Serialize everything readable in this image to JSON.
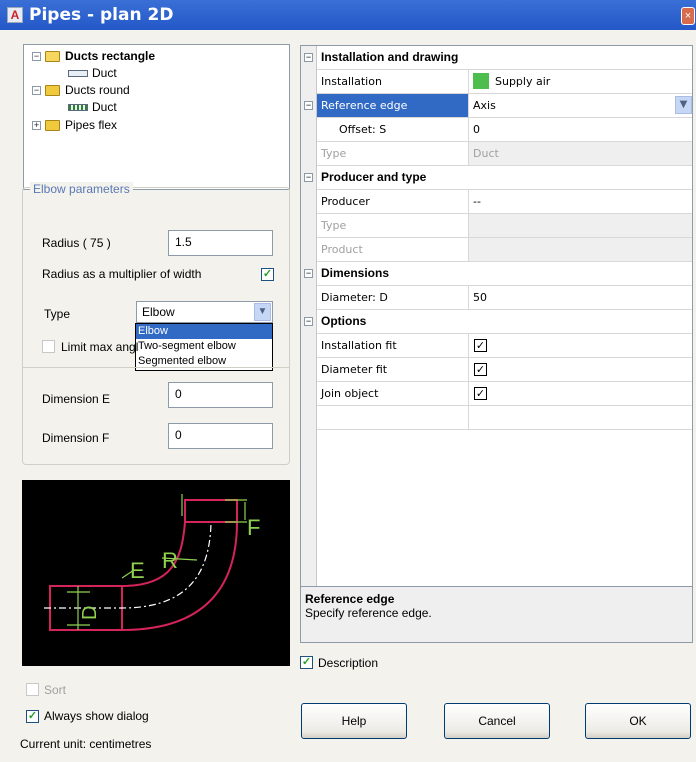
{
  "window": {
    "title": "Pipes - plan 2D",
    "app_icon_letter": "A",
    "close_glyph": "×"
  },
  "tree": {
    "items": [
      {
        "label": "Ducts rectangle",
        "expand": "−",
        "bold": true
      },
      {
        "label": "Duct"
      },
      {
        "label": "Ducts round",
        "expand": "−"
      },
      {
        "label": "Duct"
      },
      {
        "label": "Pipes flex",
        "expand": "+"
      }
    ]
  },
  "elbow": {
    "group_title": "Elbow parameters",
    "radius_label": "Radius ( 75 )",
    "radius_value": "1.5",
    "multiplier_label": "Radius as a multiplier of width",
    "multiplier_checked": true,
    "type_label": "Type",
    "type_value": "Elbow",
    "type_options": [
      "Elbow",
      "Two-segment elbow",
      "Segmented elbow"
    ],
    "limit_label": "Limit max angl",
    "dim_e_label": "Dimension E",
    "dim_e_value": "0",
    "dim_f_label": "Dimension F",
    "dim_f_value": "0"
  },
  "preview": {
    "label_e": "E",
    "label_r": "R",
    "label_f": "F",
    "label_d": "D"
  },
  "bottom_left": {
    "sort_label": "Sort",
    "always_show_label": "Always show dialog",
    "current_unit": "Current unit: centimetres"
  },
  "props": {
    "cat_install": "Installation and drawing",
    "installation_key": "Installation",
    "installation_value": "Supply air",
    "installation_color": "#4dbd4d",
    "ref_edge_key": "Reference edge",
    "ref_edge_value": "Axis",
    "offset_key": "Offset: S",
    "offset_value": "0",
    "type_key": "Type",
    "type_value": "Duct",
    "cat_producer": "Producer and type",
    "producer_key": "Producer",
    "producer_value": "--",
    "ptype_key": "Type",
    "product_key": "Product",
    "cat_dimensions": "Dimensions",
    "diameter_key": "Diameter: D",
    "diameter_value": "50",
    "cat_options": "Options",
    "inst_fit_key": "Installation fit",
    "diam_fit_key": "Diameter fit",
    "join_key": "Join object",
    "check_glyph": "✓",
    "minus_glyph": "−"
  },
  "description": {
    "title": "Reference edge",
    "text": "Specify reference edge.",
    "checkbox_label": "Description"
  },
  "buttons": {
    "help": "Help",
    "cancel": "Cancel",
    "ok": "OK"
  }
}
